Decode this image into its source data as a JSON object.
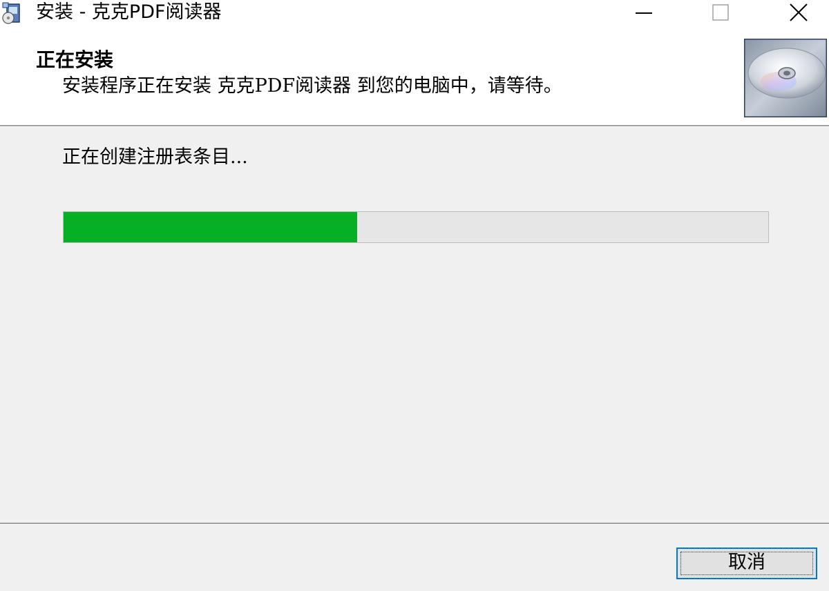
{
  "window": {
    "title": "安装 - 克克PDF阅读器",
    "icons": {
      "app": "installer-icon",
      "minimize": "minimize-icon",
      "maximize": "maximize-icon",
      "close": "close-icon"
    }
  },
  "header": {
    "title": "正在安装",
    "subtitle": "安装程序正在安装 克克PDF阅读器 到您的电脑中，请等待。",
    "image": "disc-icon"
  },
  "body": {
    "status": "正在创建注册表条目...",
    "progress_fraction": 0.417,
    "progress_color": "#06b025"
  },
  "footer": {
    "cancel_label": "取消"
  }
}
